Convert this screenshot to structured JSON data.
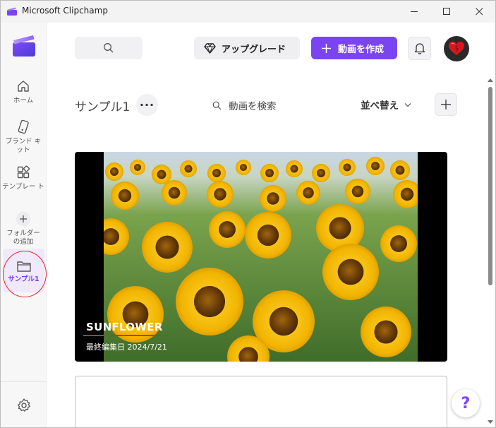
{
  "window": {
    "title": "Microsoft Clipchamp"
  },
  "sidebar": {
    "items": [
      {
        "label": "ホーム",
        "icon": "home-icon"
      },
      {
        "label": "ブランド キット",
        "icon": "brand-kit-icon"
      },
      {
        "label": "テンプレー ト",
        "icon": "template-icon"
      },
      {
        "label": "フォルダー の追加",
        "icon": "plus-icon"
      },
      {
        "label": "サンプル1",
        "icon": "folder-icon",
        "active": true
      }
    ],
    "settings_icon": "gear-icon"
  },
  "topbar": {
    "upgrade_label": "アップグレード",
    "create_label": "動画を作成"
  },
  "content": {
    "folder_title": "サンプル1",
    "more_label": "···",
    "search_label": "動画を検索",
    "sort_label": "並べ替え"
  },
  "video": {
    "title": "SUNFLOWER",
    "date": "最終編集日 2024/7/21"
  },
  "help_label": "?",
  "colors": {
    "accent": "#7b44f2",
    "annotation_red": "#e2262b"
  }
}
